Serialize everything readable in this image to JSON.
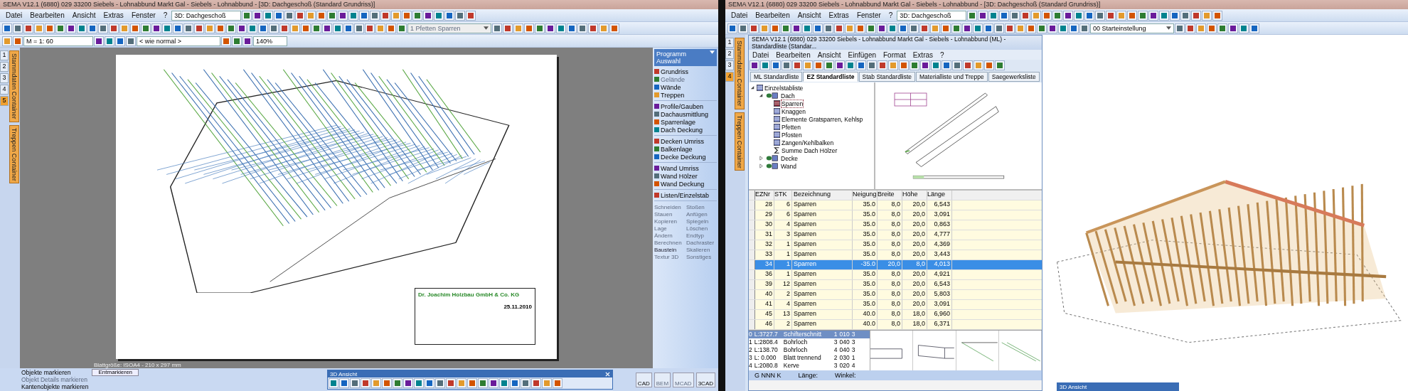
{
  "left": {
    "title": "SEMA V12.1 (6880) 029 33200 Siebels - Lohnabbund Markt Gal - Siebels - Lohnabbund  - [3D: Dachgeschoß (Standard Grundriss)]",
    "menu": [
      "Datei",
      "Bearbeiten",
      "Ansicht",
      "Extras",
      "Fenster",
      "?"
    ],
    "view_select": "3D: Dachgeschoß",
    "layer_select": {
      "value": "1 Pfetten Sparren",
      "disabled": true
    },
    "scale_field": "M = 1: 60",
    "style_select": "< wie normal >",
    "zoom_select": "140%",
    "side_numbers": [
      {
        "label": "1",
        "selected": false
      },
      {
        "label": "2",
        "selected": false
      },
      {
        "label": "3",
        "selected": false
      },
      {
        "label": "4",
        "selected": false
      },
      {
        "label": "5",
        "selected": true
      }
    ],
    "side_tabs": [
      "Stammdaten Container",
      "Treppen Container"
    ],
    "title_block": {
      "company": "Dr. Joachim Holzbau GmbH & Co. KG",
      "date": "25.11.2010"
    },
    "sheet_size": "Blattgröße: ISOA4 - 210 x 297 mm",
    "program_menu": {
      "title": "Programm Auswahl",
      "groups": [
        [
          {
            "label": "Grundriss",
            "disabled": false
          },
          {
            "label": "Gelände",
            "disabled": true
          },
          {
            "label": "Wände",
            "disabled": false
          },
          {
            "label": "Treppen",
            "disabled": false
          }
        ],
        [
          {
            "label": "Profile/Gauben",
            "disabled": false
          },
          {
            "label": "Dachausmittlung",
            "disabled": false
          },
          {
            "label": "Sparrenlage",
            "disabled": false
          },
          {
            "label": "Dach Deckung",
            "disabled": false
          }
        ],
        [
          {
            "label": "Decken Umriss",
            "disabled": false
          },
          {
            "label": "Balkenlage",
            "disabled": false
          },
          {
            "label": "Decke Deckung",
            "disabled": false
          }
        ],
        [
          {
            "label": "Wand Umriss",
            "disabled": false
          },
          {
            "label": "Wand Hölzer",
            "disabled": false
          },
          {
            "label": "Wand Deckung",
            "disabled": false
          }
        ],
        [
          {
            "label": "Listen/Einzelstab",
            "disabled": false
          }
        ]
      ]
    },
    "commands": [
      {
        "label": "Schneiden",
        "disabled": true
      },
      {
        "label": "Stoßen",
        "disabled": true
      },
      {
        "label": "Stauen",
        "disabled": true
      },
      {
        "label": "Anfügen",
        "disabled": true
      },
      {
        "label": "Kopieren",
        "disabled": true
      },
      {
        "label": "Spiegeln",
        "disabled": true
      },
      {
        "label": "Lage",
        "disabled": true
      },
      {
        "label": "Löschen",
        "disabled": true
      },
      {
        "label": "Ändern",
        "disabled": true
      },
      {
        "label": "Endtyp",
        "disabled": true
      },
      {
        "label": "Berechnen",
        "disabled": true
      },
      {
        "label": "Dachraster",
        "disabled": true
      },
      {
        "label": "Baustein",
        "disabled": false
      },
      {
        "label": "Skalieren",
        "disabled": true
      },
      {
        "label": "Textur 3D",
        "disabled": true
      },
      {
        "label": "Sonstiges",
        "disabled": true
      }
    ],
    "mark_panel": {
      "items": [
        {
          "label": "Objekte markieren",
          "disabled": false
        },
        {
          "label": "Objekt Details markieren",
          "disabled": true
        },
        {
          "label": "Kantenobjekte markieren",
          "disabled": false
        }
      ],
      "button": "Entmarkieren"
    },
    "view_window_title": "3D Ansicht",
    "modes": [
      {
        "label": "CAD",
        "disabled": false
      },
      {
        "label": "BEM",
        "disabled": true
      },
      {
        "label": "MCAD",
        "disabled": true
      },
      {
        "label": "3CAD",
        "disabled": false
      }
    ]
  },
  "right": {
    "title": "SEMA V12.1 (6880) 029 33200 Siebels - Lohnabbund Markt Gal - Siebels - Lohnabbund  - [3D: Dachgeschoß (Standard Grundriss)]",
    "menu": [
      "Datei",
      "Bearbeiten",
      "Ansicht",
      "Extras",
      "Fenster",
      "?"
    ],
    "view_select": "3D: Dachgeschoß",
    "preset_select": "00 Starteinstellung",
    "side_numbers": [
      {
        "label": "1",
        "selected": false
      },
      {
        "label": "2",
        "selected": false
      },
      {
        "label": "3",
        "selected": false
      },
      {
        "label": "4",
        "selected": true
      }
    ],
    "side_tabs": [
      "Stammdaten Container",
      "Treppen Container"
    ],
    "list_window": {
      "title": "SEMA V12.1 (6880) 029 33200 Siebels - Lohnabbund Markt Gal - Siebels - Lohnabbund   (ML) - Standardliste (Standar...",
      "menu": [
        "Datei",
        "Bearbeiten",
        "Ansicht",
        "Einfügen",
        "Format",
        "Extras",
        "?"
      ],
      "tabs": [
        {
          "label": "ML Standardliste",
          "selected": false
        },
        {
          "label": "EZ Standardliste",
          "selected": true
        },
        {
          "label": "Stab Standardliste",
          "selected": false
        },
        {
          "label": "Materialliste und Treppe",
          "selected": false
        },
        {
          "label": "Saegewerksliste",
          "selected": false
        }
      ],
      "tree": [
        {
          "label": "Einzelstabliste",
          "kind": "list",
          "selected": false,
          "expanded": true,
          "children": [
            {
              "label": "Dach",
              "kind": "group",
              "selected": false,
              "expanded": true,
              "children": [
                {
                  "label": "Sparren",
                  "kind": "list",
                  "selected": true
                },
                {
                  "label": "Knaggen",
                  "kind": "list",
                  "selected": false
                },
                {
                  "label": "Elemente Gratsparren, Kehlsp",
                  "kind": "list",
                  "selected": false
                },
                {
                  "label": "Pfetten",
                  "kind": "list",
                  "selected": false
                },
                {
                  "label": "Pfosten",
                  "kind": "list",
                  "selected": false
                },
                {
                  "label": "Zangen/Kehlbalken",
                  "kind": "list",
                  "selected": false
                },
                {
                  "label": "Summe Dach Hölzer",
                  "kind": "sum",
                  "selected": false
                }
              ]
            },
            {
              "label": "Decke",
              "kind": "group",
              "selected": false,
              "expanded": false
            },
            {
              "label": "Wand",
              "kind": "group",
              "selected": false,
              "expanded": false
            }
          ]
        }
      ],
      "table": {
        "columns": [
          "EZNr",
          "STK",
          "Bezeichnung",
          "Neigung",
          "Breite",
          "Höhe",
          "Länge"
        ],
        "rows": [
          {
            "cells": [
              "28",
              "6",
              "Sparren",
              "35.0",
              "8,0",
              "20,0",
              "6,543"
            ],
            "selected": false
          },
          {
            "cells": [
              "29",
              "6",
              "Sparren",
              "35.0",
              "8,0",
              "20,0",
              "3,091"
            ],
            "selected": false
          },
          {
            "cells": [
              "30",
              "4",
              "Sparren",
              "35.0",
              "8,0",
              "20,0",
              "0,863"
            ],
            "selected": false
          },
          {
            "cells": [
              "31",
              "3",
              "Sparren",
              "35.0",
              "8,0",
              "20,0",
              "4,777"
            ],
            "selected": false
          },
          {
            "cells": [
              "32",
              "1",
              "Sparren",
              "35.0",
              "8,0",
              "20,0",
              "4,369"
            ],
            "selected": false
          },
          {
            "cells": [
              "33",
              "1",
              "Sparren",
              "35.0",
              "8,0",
              "20,0",
              "3,443"
            ],
            "selected": false
          },
          {
            "cells": [
              "34",
              "1",
              "Sparren",
              "-35.0",
              "20,0",
              "8,0",
              "4,013"
            ],
            "selected": true
          },
          {
            "cells": [
              "36",
              "1",
              "Sparren",
              "35.0",
              "8,0",
              "20,0",
              "4,921"
            ],
            "selected": false
          },
          {
            "cells": [
              "39",
              "12",
              "Sparren",
              "35.0",
              "8,0",
              "20,0",
              "6,543"
            ],
            "selected": false
          },
          {
            "cells": [
              "40",
              "2",
              "Sparren",
              "35.0",
              "8,0",
              "20,0",
              "5,803"
            ],
            "selected": false
          },
          {
            "cells": [
              "41",
              "4",
              "Sparren",
              "35.0",
              "8,0",
              "20,0",
              "3,091"
            ],
            "selected": false
          },
          {
            "cells": [
              "45",
              "13",
              "Sparren",
              "40.0",
              "8,0",
              "18,0",
              "6,960"
            ],
            "selected": false
          },
          {
            "cells": [
              "46",
              "2",
              "Sparren",
              "40.0",
              "8,0",
              "18,0",
              "6,371"
            ],
            "selected": false
          }
        ]
      },
      "details": [
        {
          "cells": [
            "0",
            "L:3727.7",
            "Schifterschnitt",
            "1",
            "010",
            "3"
          ],
          "selected": true
        },
        {
          "cells": [
            "1",
            "L:2808.4",
            "Bohrloch",
            "3",
            "040",
            "3"
          ],
          "selected": false
        },
        {
          "cells": [
            "2",
            "L:138.70",
            "Bohrloch",
            "4",
            "040",
            "3"
          ],
          "selected": false
        },
        {
          "cells": [
            "3",
            "L:  0.000",
            "Blatt trennend",
            "2",
            "030",
            "1"
          ],
          "selected": false
        },
        {
          "cells": [
            "4",
            "L:2080.8",
            "Kerve",
            "3",
            "020",
            "4"
          ],
          "selected": false
        }
      ],
      "status": [
        "G  NNN K",
        "Länge:",
        "Winkel:"
      ]
    },
    "view_window_title": "3D Ansicht"
  }
}
